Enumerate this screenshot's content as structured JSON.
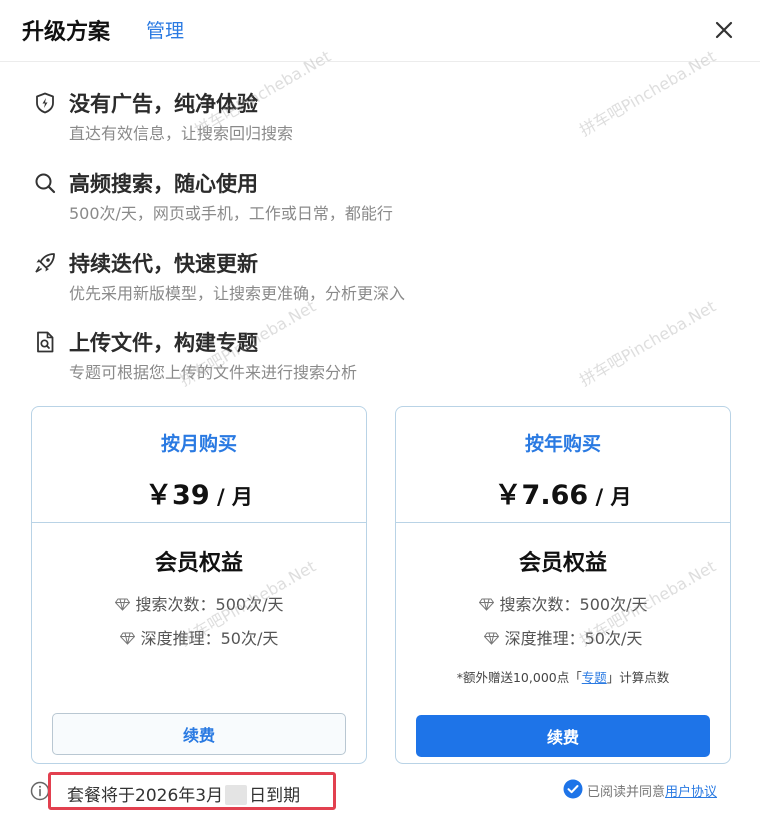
{
  "header": {
    "title": "升级方案",
    "manage_label": "管理",
    "close_icon": "close-icon"
  },
  "features": [
    {
      "icon": "shield-icon",
      "title": "没有广告，纯净体验",
      "subtitle": "直达有效信息，让搜索回归搜索"
    },
    {
      "icon": "search-icon",
      "title": "高频搜索，随心使用",
      "subtitle": "500次/天，网页或手机，工作或日常，都能行"
    },
    {
      "icon": "rocket-icon",
      "title": "持续迭代，快速更新",
      "subtitle": "优先采用新版模型，让搜索更准确，分析更深入"
    },
    {
      "icon": "file-search-icon",
      "title": "上传文件，构建专题",
      "subtitle": "专题可根据您上传的文件来进行搜索分析"
    }
  ],
  "plans": {
    "monthly": {
      "name": "按月购买",
      "price": "￥39",
      "unit": " / 月",
      "benefits_title": "会员权益",
      "benefits": [
        "搜索次数：500次/天",
        "深度推理：50次/天"
      ],
      "button": "续费"
    },
    "yearly": {
      "name": "按年购买",
      "price": "￥7.66",
      "unit": " / 月",
      "benefits_title": "会员权益",
      "benefits": [
        "搜索次数：500次/天",
        "深度推理：50次/天"
      ],
      "extra_prefix": "*额外赠送10,000点「",
      "extra_link": "专题",
      "extra_suffix": "」计算点数",
      "button": "续费"
    }
  },
  "footer": {
    "expire_prefix": "套餐将于2026年3月",
    "expire_suffix": "日到期",
    "agree_text": "已阅读并同意",
    "agree_link": "用户协议"
  },
  "watermark": "拼车吧Pincheba.Net",
  "colors": {
    "accent": "#2a7ae2",
    "primary_button": "#1e74e8",
    "highlight_border": "#e2404f",
    "card_border": "#b9d3e6"
  }
}
